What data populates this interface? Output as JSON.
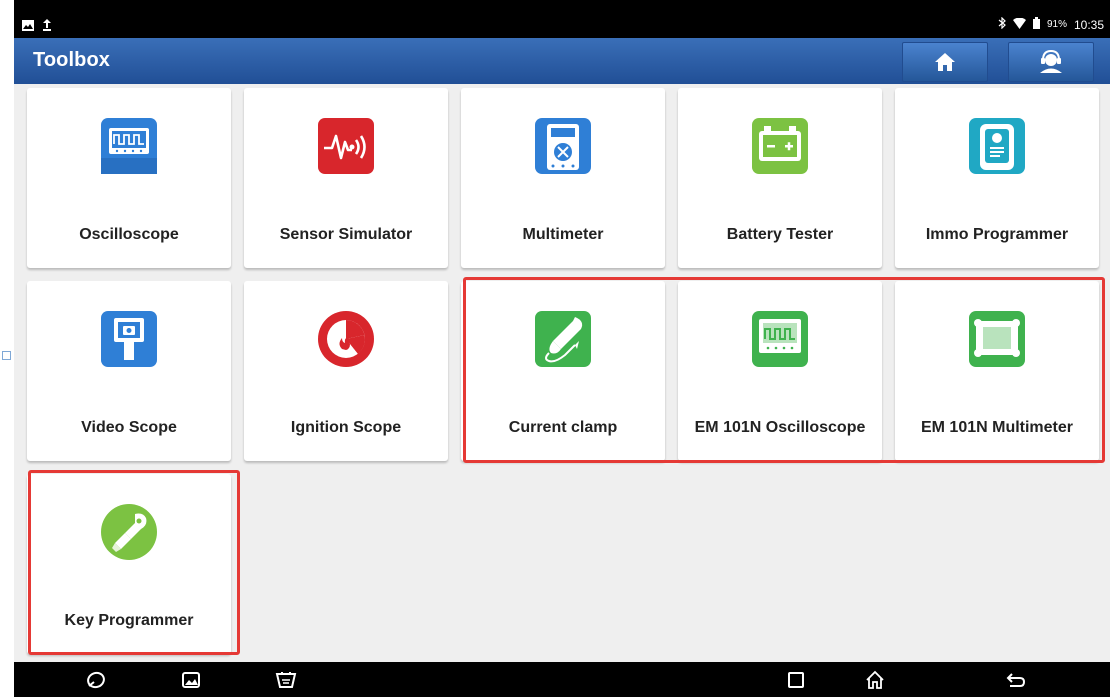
{
  "status_bar": {
    "battery": "91%",
    "time": "10:35"
  },
  "header": {
    "title": "Toolbox"
  },
  "tools": [
    {
      "label": "Oscilloscope",
      "icon": "oscilloscope-icon"
    },
    {
      "label": "Sensor Simulator",
      "icon": "sensor-simulator-icon"
    },
    {
      "label": "Multimeter",
      "icon": "multimeter-icon"
    },
    {
      "label": "Battery Tester",
      "icon": "battery-icon"
    },
    {
      "label": "Immo Programmer",
      "icon": "immo-programmer-icon"
    },
    {
      "label": "Video Scope",
      "icon": "video-scope-icon"
    },
    {
      "label": "Ignition Scope",
      "icon": "ignition-scope-icon"
    },
    {
      "label": "Current clamp",
      "icon": "current-clamp-icon"
    },
    {
      "label": "EM 101N Oscilloscope",
      "icon": "em101n-oscilloscope-icon"
    },
    {
      "label": "EM 101N Multimeter",
      "icon": "em101n-multimeter-icon"
    },
    {
      "label": "Key Programmer",
      "icon": "key-programmer-icon"
    }
  ],
  "colors": {
    "header_blue": "#2c5fa8",
    "highlight_red": "#e53935",
    "icon_blue": "#2f7fd6",
    "icon_red": "#d8262c",
    "icon_green": "#3fb24e",
    "icon_lime": "#7cc242",
    "icon_teal": "#20a8c4"
  }
}
